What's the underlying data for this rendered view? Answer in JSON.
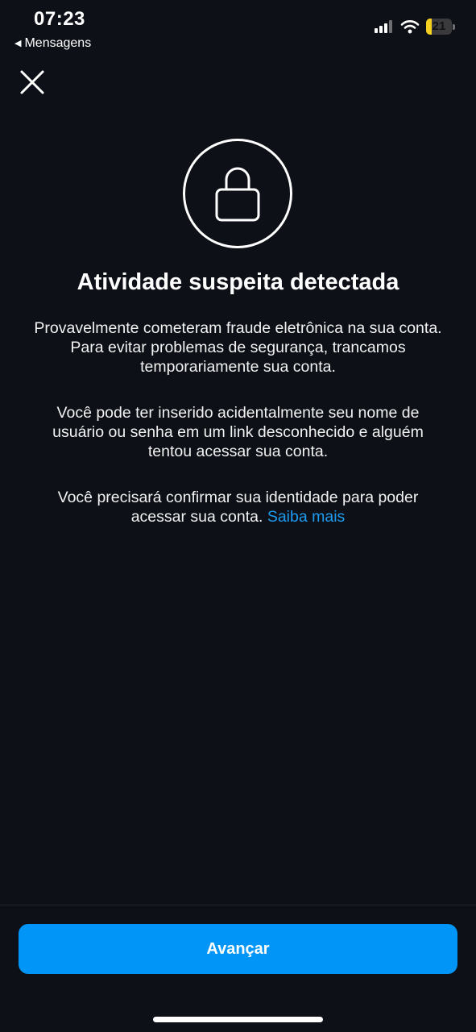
{
  "status_bar": {
    "time": "07:23",
    "back_app_label": "Mensagens",
    "battery_level": "21",
    "battery_fraction": 0.21
  },
  "icons": {
    "close": "close-icon",
    "lock": "lock-icon",
    "signal": "cellular-signal-icon",
    "wifi": "wifi-icon",
    "battery": "battery-icon"
  },
  "content": {
    "title": "Atividade suspeita detectada",
    "paragraph_1": "Provavelmente cometeram fraude eletrônica na sua conta. Para evitar problemas de segurança, trancamos temporariamente sua conta.",
    "paragraph_2": "Você pode ter inserido acidentalmente seu nome de usuário ou senha em um link desconhecido e alguém tentou acessar sua conta.",
    "paragraph_3": "Você precisará confirmar sua identidade para poder acessar sua conta.",
    "learn_more_link": "Saiba mais"
  },
  "footer": {
    "primary_button_label": "Avançar"
  },
  "colors": {
    "background": "#0d1117",
    "accent": "#0095f6",
    "link": "#1d9bf0",
    "battery_fill": "#f5d020"
  }
}
